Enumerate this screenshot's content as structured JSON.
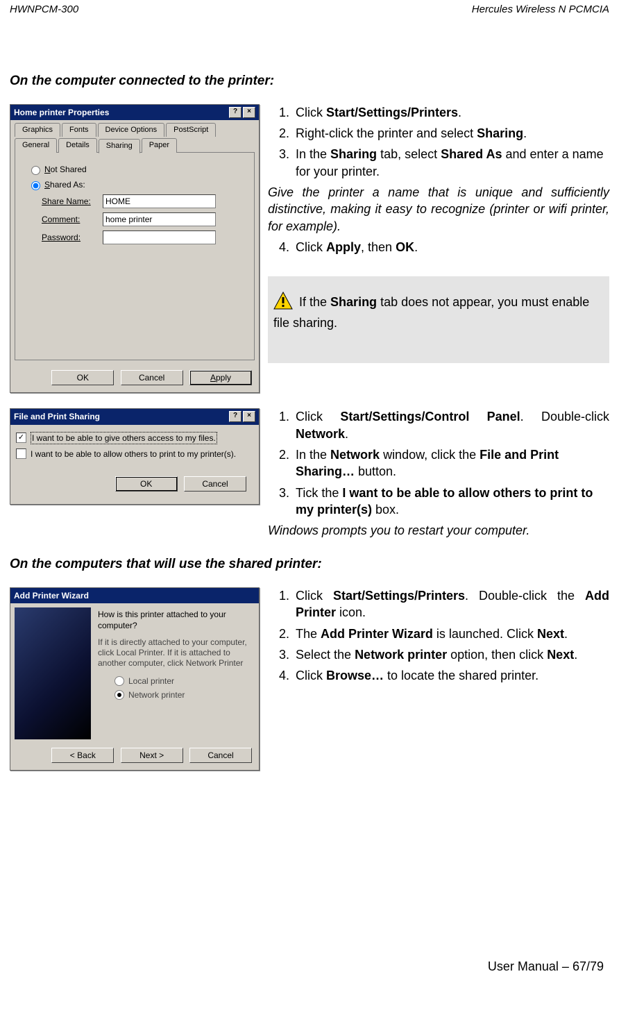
{
  "header": {
    "left": "HWNPCM-300",
    "right": "Hercules Wireless N PCMCIA"
  },
  "sections": {
    "a": {
      "title": "On the computer connected to the printer:"
    },
    "b": {
      "title": "On the computers that will use the shared printer:"
    }
  },
  "dlg1": {
    "title": "Home printer Properties",
    "help": "?",
    "close": "×",
    "tabs": {
      "graphics": "Graphics",
      "fonts": "Fonts",
      "device": "Device Options",
      "postscript": "PostScript",
      "general": "General",
      "details": "Details",
      "sharing": "Sharing",
      "paper": "Paper"
    },
    "radio_not_shared": "Not Shared",
    "radio_shared_as": "Shared As:",
    "labels": {
      "share_name": "Share Name:",
      "comment": "Comment:",
      "password": "Password:"
    },
    "values": {
      "share_name": "HOME",
      "comment": "home printer",
      "password": ""
    },
    "buttons": {
      "ok": "OK",
      "cancel": "Cancel",
      "apply": "Apply"
    }
  },
  "steps1": {
    "s1_a": "Click ",
    "s1_b": "Start/Settings/Printers",
    "s1_c": ".",
    "s2_a": "Right-click the printer and select ",
    "s2_b": "Sharing",
    "s2_c": ".",
    "s3_a": "In the ",
    "s3_b": "Sharing",
    "s3_c": " tab, select ",
    "s3_d": "Shared As",
    "s3_e": " and enter a name for your printer.",
    "tip": "Give the printer a name that is unique and sufficiently distinctive, making it easy to recognize (printer or wifi printer, for example).",
    "s4_a": "Click ",
    "s4_b": "Apply",
    "s4_c": ", then ",
    "s4_d": "OK",
    "s4_e": "."
  },
  "note": {
    "a": " If the ",
    "b": "Sharing",
    "c": " tab does not appear, you must enable file sharing."
  },
  "dlg2": {
    "title": "File and Print Sharing",
    "help": "?",
    "close": "×",
    "opt_files": "I want to be able to give others access to my files.",
    "opt_print": "I want to be able to allow others to print to my printer(s).",
    "ok": "OK",
    "cancel": "Cancel"
  },
  "steps2": {
    "s1_a": "Click ",
    "s1_b": "Start/Settings/Control Panel",
    "s1_c": ". Double-click ",
    "s1_d": "Network",
    "s1_e": ".",
    "s2_a": "In the ",
    "s2_b": "Network",
    "s2_c": " window, click the ",
    "s2_d": "File and Print Sharing…",
    "s2_e": " button.",
    "s3_a": "Tick the ",
    "s3_b": "I want to be able to allow others to print to my printer(s)",
    "s3_c": " box.",
    "restart": "Windows prompts you to restart your computer."
  },
  "dlg3": {
    "title": "Add Printer Wizard",
    "q": "How is this printer attached to your computer?",
    "hint": "If it is directly attached to your computer, click Local Printer. If it is attached to another computer, click Network Printer",
    "opt_local": "Local printer",
    "opt_net": "Network printer",
    "back": "< Back",
    "next": "Next >",
    "cancel": "Cancel"
  },
  "steps3": {
    "s1_a": "Click ",
    "s1_b": "Start/Settings/Printers",
    "s1_c": ".  Double-click the ",
    "s1_d": "Add Printer",
    "s1_e": " icon.",
    "s2_a": "The ",
    "s2_b": "Add Printer Wizard",
    "s2_c": " is launched.  Click ",
    "s2_d": "Next",
    "s2_e": ".",
    "s3_a": "Select the ",
    "s3_b": "Network printer",
    "s3_c": " option, then click ",
    "s3_d": "Next",
    "s3_e": ".",
    "s4_a": "Click ",
    "s4_b": "Browse…",
    "s4_c": " to locate the shared printer."
  },
  "footer": "User Manual – 67/79"
}
